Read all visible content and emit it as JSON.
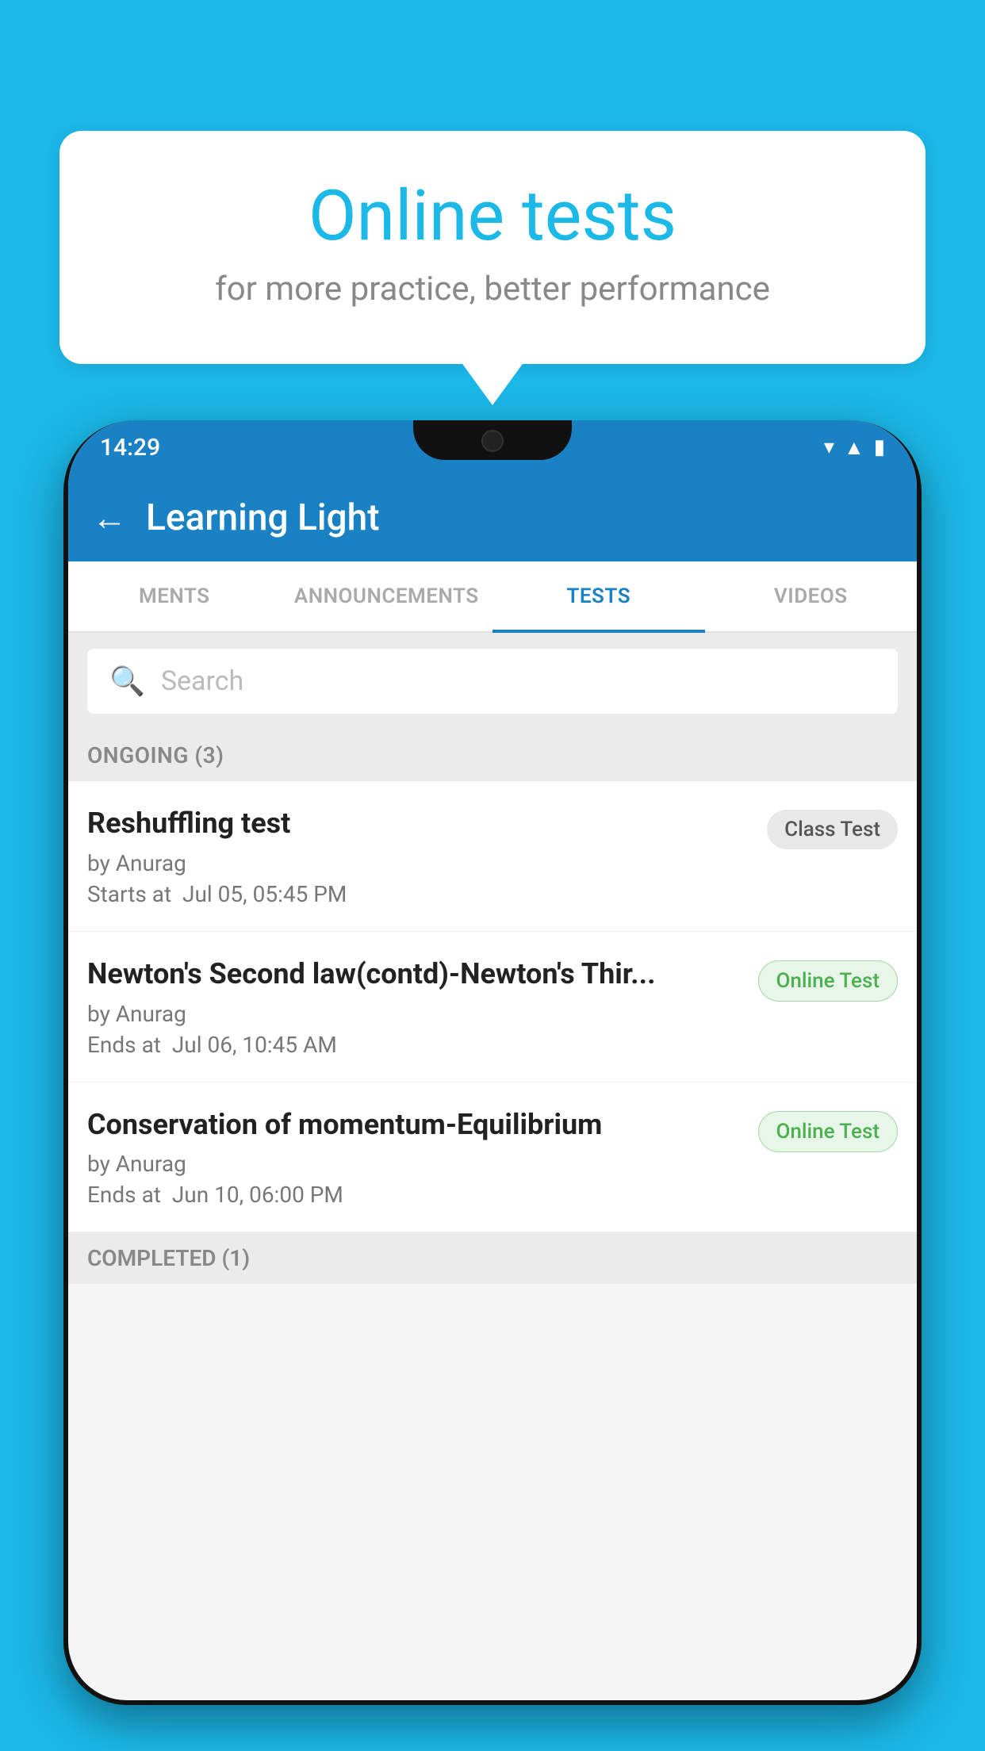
{
  "background_color": "#1bb8e8",
  "speech_bubble": {
    "title": "Online tests",
    "subtitle": "for more practice, better performance"
  },
  "phone": {
    "status_bar": {
      "time": "14:29",
      "icons": [
        "wifi",
        "signal",
        "battery"
      ]
    },
    "app_bar": {
      "title": "Learning Light",
      "back_label": "←"
    },
    "tabs": [
      {
        "label": "MENTS",
        "active": false
      },
      {
        "label": "ANNOUNCEMENTS",
        "active": false
      },
      {
        "label": "TESTS",
        "active": true
      },
      {
        "label": "VIDEOS",
        "active": false
      }
    ],
    "search": {
      "placeholder": "Search"
    },
    "ongoing_section": {
      "title": "ONGOING (3)",
      "items": [
        {
          "name": "Reshuffling test",
          "author": "by Anurag",
          "time_label": "Starts at",
          "time_value": "Jul 05, 05:45 PM",
          "badge": "Class Test",
          "badge_type": "class"
        },
        {
          "name": "Newton's Second law(contd)-Newton's Thir...",
          "author": "by Anurag",
          "time_label": "Ends at",
          "time_value": "Jul 06, 10:45 AM",
          "badge": "Online Test",
          "badge_type": "online"
        },
        {
          "name": "Conservation of momentum-Equilibrium",
          "author": "by Anurag",
          "time_label": "Ends at",
          "time_value": "Jun 10, 06:00 PM",
          "badge": "Online Test",
          "badge_type": "online"
        }
      ]
    },
    "completed_section": {
      "title": "COMPLETED (1)"
    }
  }
}
